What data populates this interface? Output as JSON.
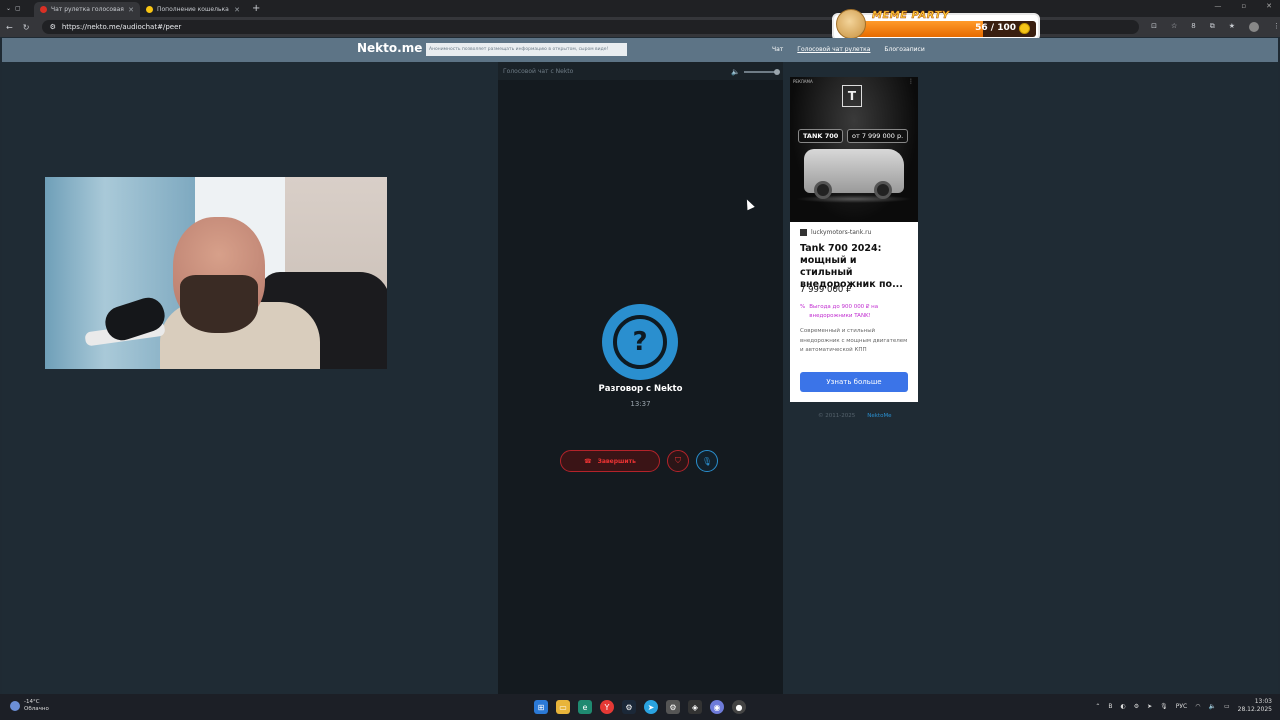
{
  "browser": {
    "tabs": [
      {
        "title": "Чат рулетка голосовая — N",
        "active": true,
        "favicon_color": "#d93025"
      },
      {
        "title": "Пополнение кошелька | Dragon",
        "active": false,
        "favicon_color": "#f9c513"
      }
    ],
    "url": "https://nekto.me/audiochat#/peer",
    "ext_badge": "8"
  },
  "overlay": {
    "brand": "MEME PARTY",
    "progress_text": "56 / 100",
    "progress_fraction": 0.56
  },
  "site": {
    "logo": "Nekto.me",
    "notice": "Анонимность позволяет размещать информацию в открытом, сыром виде!",
    "nav": [
      "Чат",
      "Голосовой чат рулетка",
      "Блогозаписи"
    ],
    "nav_current_index": 1
  },
  "chat": {
    "header": "Голосовой чат с Nekto",
    "peer_symbol": "?",
    "peer_name": "Разговор с Nekto",
    "timer": "13:37",
    "end_label": "Завершить",
    "end_icon": "phone-hangup-icon",
    "shield_icon": "shield-icon",
    "mic_icon": "microphone-icon",
    "accent": "#2a8fcf",
    "danger": "#b4232a"
  },
  "ad": {
    "label": "РЕКЛАМА",
    "logo_letter": "T",
    "badge_model": "TANK 700",
    "badge_price": "от 7 999 000 р.",
    "site": "luckymotors-tank.ru",
    "title": "Tank 700 2024: мощный и стильный внедорожник по...",
    "price": "7 999 000 ₽",
    "promo_mark": "%",
    "promo": "Выгода до 900 000 ₽ на внедорожники TANK!",
    "desc": "Современный и стильный внедорожник с мощным двигателем и автоматической КПП",
    "cta": "Узнать больше"
  },
  "footer": {
    "copyright": "© 2011-2025",
    "link": "NektoMe"
  },
  "taskbar": {
    "weather_temp": "-14°C",
    "weather_text": "Облачно",
    "lang": "РУС",
    "time": "13:03",
    "date": "28.12.2025",
    "tray_letter": "B"
  }
}
